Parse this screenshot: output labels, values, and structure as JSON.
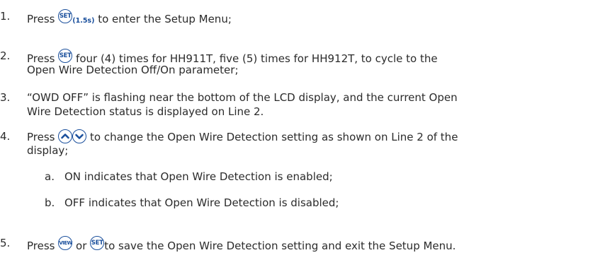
{
  "steps": [
    {
      "num": "1.",
      "pre": "Press",
      "btn": "SET",
      "dur": "(1.5s)",
      "post": "to enter the Setup Menu;"
    },
    {
      "num": "2.",
      "pre": "Press",
      "btn": "SET",
      "post": "four (4) times for HH911T, five (5) times for HH912T, to cycle to the",
      "post2": "Open Wire Detection Off/On parameter;"
    },
    {
      "num": "3.",
      "line1": "“OWD OFF” is flashing near the bottom of the LCD display, and the current Open",
      "line2": "Wire Detection status is displayed on Line 2."
    },
    {
      "num": "4.",
      "pre": "Press",
      "post": "to change the Open Wire Detection setting as shown on Line 2 of the",
      "post2": "display;"
    },
    {
      "num": "5.",
      "pre": "Press",
      "btn_view": "VIEW",
      "or": "or",
      "btn": "SET",
      "post": "to save the Open Wire Detection setting and exit the Setup Menu."
    }
  ],
  "substeps": [
    {
      "letter": "a.",
      "text": "ON indicates that Open Wire Detection is enabled;"
    },
    {
      "letter": "b.",
      "text": "OFF indicates that Open Wire Detection is disabled;"
    }
  ],
  "icons": {
    "up": "chevron-up-icon",
    "down": "chevron-down-icon",
    "accent": "#1a4f9c"
  }
}
